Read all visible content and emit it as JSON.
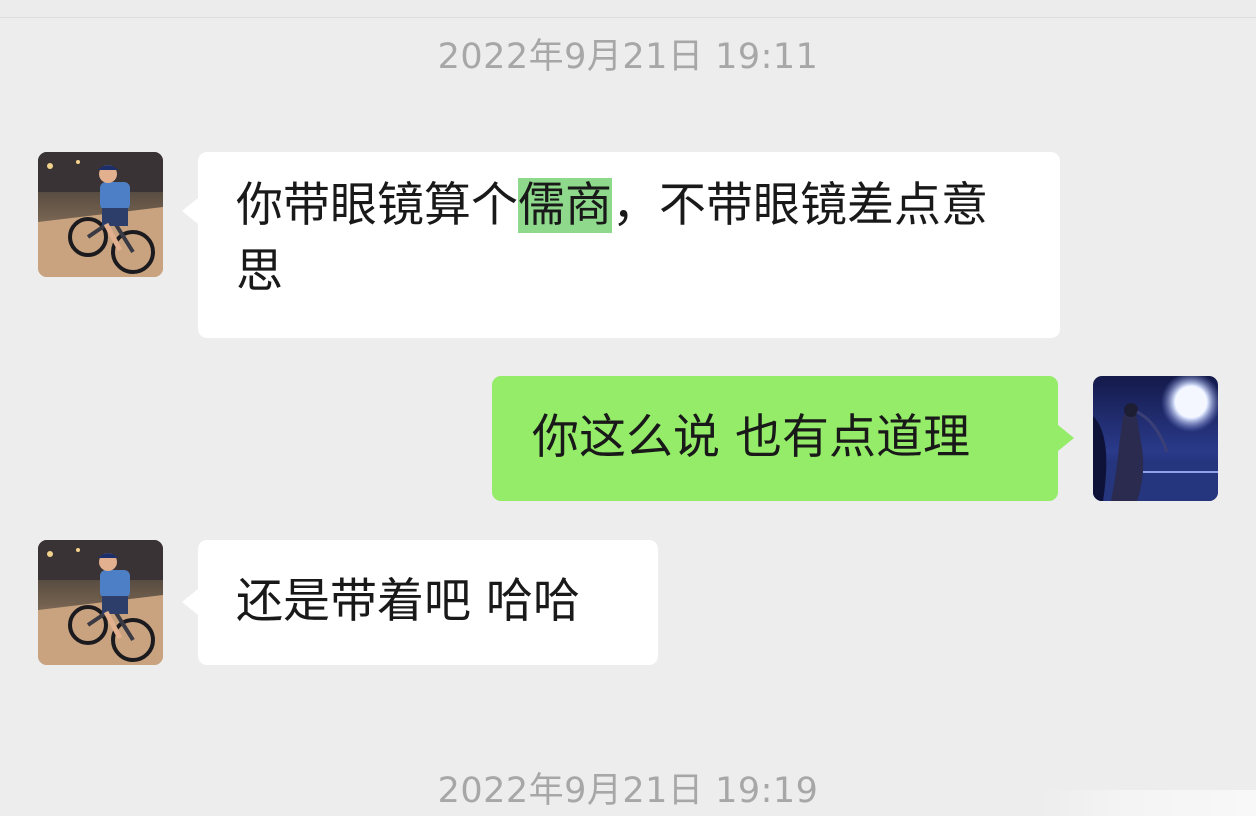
{
  "timestamps": [
    "2022年9月21日 19:11",
    "2022年9月21日 19:19"
  ],
  "messages": [
    {
      "side": "left",
      "text_before": "你带眼镜算个",
      "text_highlight": "儒商",
      "text_after": "，不带眼镜差点意思"
    },
    {
      "side": "right",
      "text": "你这么说 也有点道理"
    },
    {
      "side": "left",
      "text": "还是带着吧 哈哈"
    }
  ],
  "avatars": {
    "contact": "cyclist-avatar",
    "self": "moon-night-avatar"
  },
  "colors": {
    "background": "#ededed",
    "incoming_bubble": "#ffffff",
    "outgoing_bubble": "#95ec69",
    "selection_highlight": "#8fd98c",
    "timestamp_text": "#a7a7a7",
    "message_text": "#191919"
  }
}
